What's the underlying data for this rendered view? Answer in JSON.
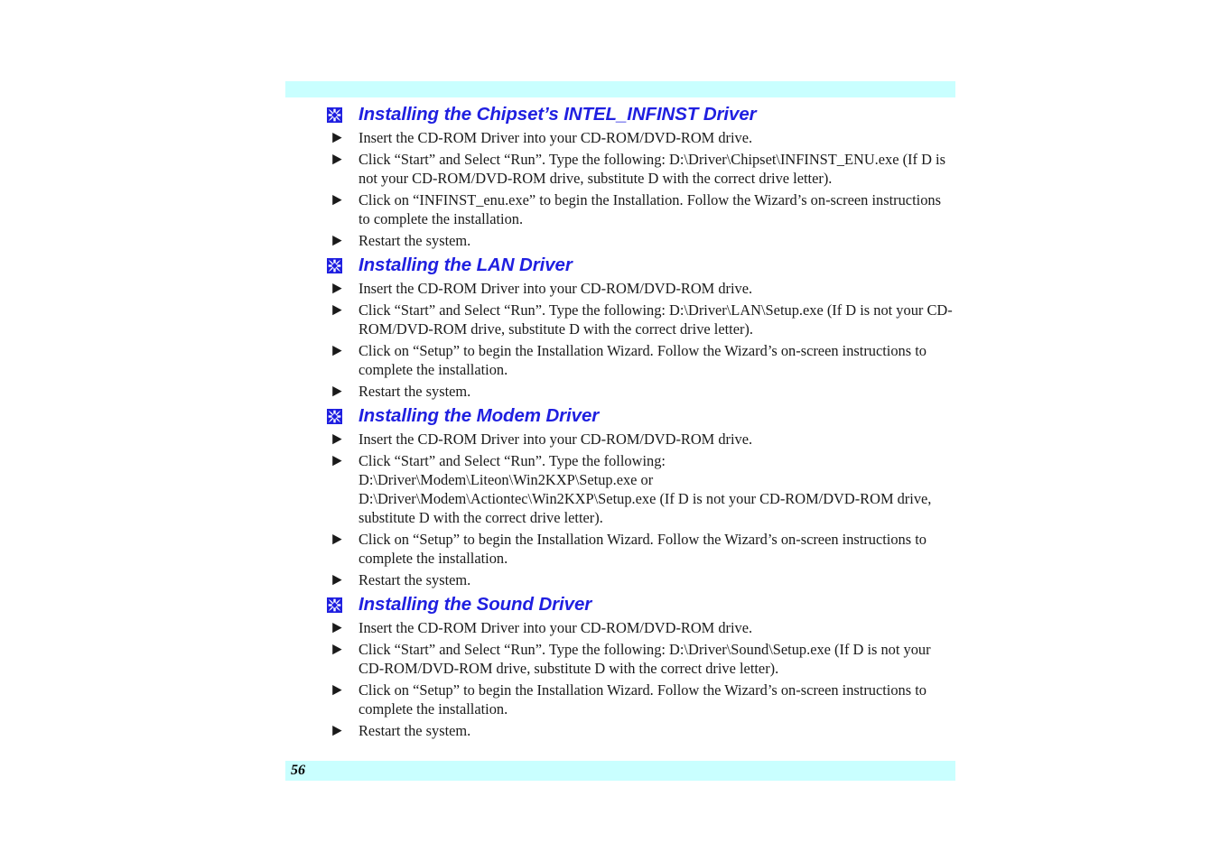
{
  "document": {
    "page_number": "56",
    "accent_bar_color": "#c9ffff",
    "heading_color": "#1f1fe0",
    "body_color": "#1a1a1a"
  },
  "sections": [
    {
      "heading": "Installing the Chipset’s INTEL_INFINST Driver",
      "marker_icon": "four-petal-square-icon",
      "items": [
        "Insert the CD-ROM Driver into your CD-ROM/DVD-ROM drive.",
        "Click “Start” and Select “Run”. Type the following: D:\\Driver\\Chipset\\INFINST_ENU.exe (If D is not your CD-ROM/DVD-ROM drive, substitute D with the correct drive letter).",
        "Click on “INFINST_enu.exe” to begin the Installation. Follow the Wizard’s on-screen instructions to complete the installation.",
        "Restart the system."
      ]
    },
    {
      "heading": "Installing the LAN Driver",
      "marker_icon": "four-petal-square-icon",
      "items": [
        "Insert the CD-ROM Driver into your CD-ROM/DVD-ROM drive.",
        "Click “Start” and Select “Run”. Type the following: D:\\Driver\\LAN\\Setup.exe (If D is not your CD-ROM/DVD-ROM drive, substitute D with the correct drive letter).",
        "Click on “Setup” to begin the Installation Wizard. Follow the Wizard’s on-screen instructions to complete the installation.",
        "Restart the system."
      ]
    },
    {
      "heading": "Installing the Modem Driver",
      "marker_icon": "four-petal-square-icon",
      "items": [
        "Insert the CD-ROM Driver into your CD-ROM/DVD-ROM drive.",
        "Click “Start” and Select “Run”.  Type the following:\nD:\\Driver\\Modem\\Liteon\\Win2KXP\\Setup.exe or\nD:\\Driver\\Modem\\Actiontec\\Win2KXP\\Setup.exe (If D is not your CD-ROM/DVD-ROM drive, substitute D with the correct drive letter).",
        "Click on “Setup” to begin the Installation Wizard. Follow the Wizard’s on-screen instructions to complete the installation.",
        "Restart the system."
      ]
    },
    {
      "heading": "Installing the Sound Driver",
      "marker_icon": "four-petal-square-icon",
      "items": [
        "Insert the CD-ROM Driver into your CD-ROM/DVD-ROM drive.",
        "Click “Start” and Select “Run”. Type the following: D:\\Driver\\Sound\\Setup.exe (If D is not your CD-ROM/DVD-ROM drive, substitute D with the correct drive letter).",
        "Click on “Setup” to begin the Installation Wizard. Follow the Wizard’s on-screen instructions to complete the installation.",
        "Restart the system."
      ]
    }
  ]
}
